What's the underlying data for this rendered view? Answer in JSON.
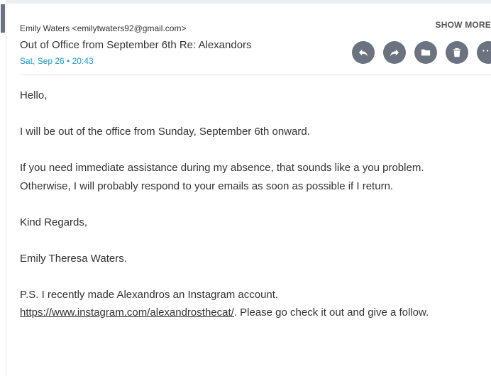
{
  "email": {
    "sender": "Emily Waters <emilytwaters92@gmail.com>",
    "subject": "Out of Office from September 6th Re: Alexandors",
    "date": "Sat, Sep 26 • 20:43",
    "show_more_label": "SHOW MORE"
  },
  "actions": [
    {
      "name": "reply-icon"
    },
    {
      "name": "forward-icon"
    },
    {
      "name": "folder-icon"
    },
    {
      "name": "trash-icon"
    },
    {
      "name": "more-icon"
    }
  ],
  "body": {
    "greeting": "Hello,",
    "line1": "I will be out of the office from Sunday, September 6th onward.",
    "line2": "If you need immediate assistance during my absence, that sounds like a you problem. Otherwise, I will probably respond to your emails as soon as possible if I return.",
    "closing": "Kind Regards,",
    "signature": "Emily Theresa Waters.",
    "ps_prefix": "P.S. I recently made Alexandros an Instagram account.",
    "link_text": "https://www.instagram.com/alexandrosthecat/",
    "ps_suffix": ". Please go check it out and give a follow."
  },
  "colors": {
    "accent": "#1a9bd7",
    "action_button": "#6b7280"
  }
}
